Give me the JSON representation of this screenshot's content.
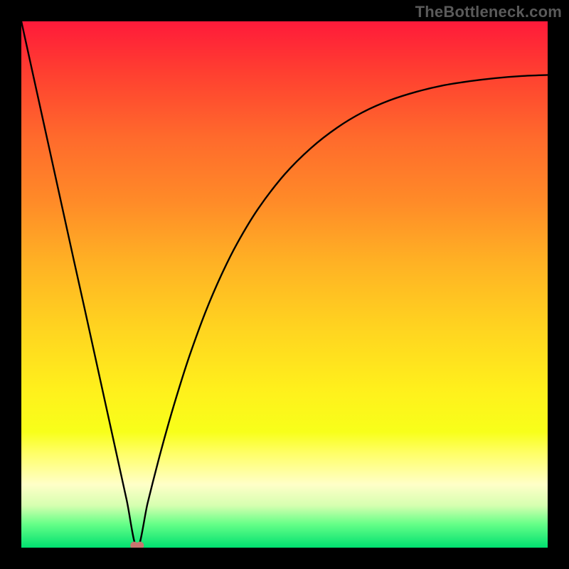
{
  "watermark": "TheBottleneck.com",
  "colors": {
    "gradient_top": "#ff1a3a",
    "gradient_bottom": "#00e070",
    "curve": "#000000",
    "marker": "#c9756f",
    "frame": "#000000"
  },
  "chart_data": {
    "type": "line",
    "title": "",
    "xlabel": "",
    "ylabel": "",
    "xlim": [
      0,
      100
    ],
    "ylim": [
      0,
      100
    ],
    "x_optimal": 22,
    "series": [
      {
        "name": "bottleneck",
        "x": [
          0,
          2,
          4,
          6,
          8,
          10,
          12,
          14,
          16,
          18,
          20,
          22,
          24,
          26,
          28,
          30,
          32,
          35,
          38,
          41,
          45,
          50,
          55,
          60,
          65,
          70,
          75,
          80,
          85,
          90,
          95,
          100
        ],
        "values": [
          100,
          90.9,
          81.8,
          72.7,
          63.6,
          54.5,
          45.5,
          36.4,
          27.3,
          18.2,
          9.1,
          0,
          8.5,
          16.4,
          23.7,
          30.4,
          36.6,
          44.8,
          51.8,
          57.8,
          64.4,
          70.9,
          75.9,
          79.8,
          82.8,
          85.0,
          86.6,
          87.8,
          88.6,
          89.2,
          89.6,
          89.8
        ]
      }
    ],
    "marker": {
      "x": 22,
      "y": 0
    }
  }
}
